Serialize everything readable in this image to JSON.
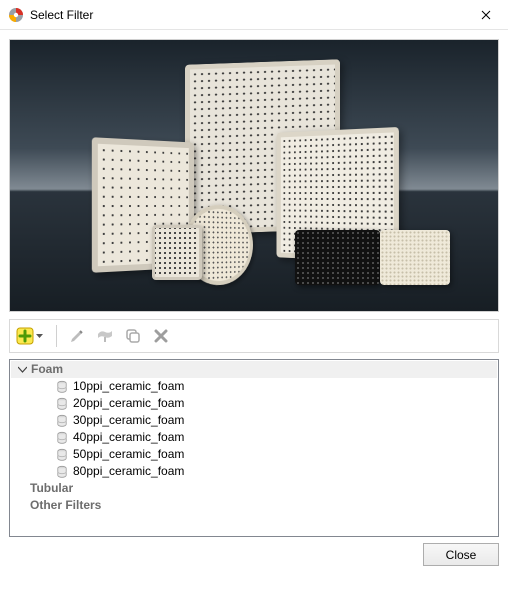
{
  "window": {
    "title": "Select Filter",
    "close_tooltip": "Close"
  },
  "toolbar": {
    "add_tooltip": "Add",
    "edit_tooltip": "Edit",
    "filter_tooltip": "Filter",
    "copy_tooltip": "Copy",
    "delete_tooltip": "Delete"
  },
  "tree": {
    "categories": [
      {
        "name": "Foam",
        "expanded": true,
        "selected": true,
        "items": [
          "10ppi_ceramic_foam",
          "20ppi_ceramic_foam",
          "30ppi_ceramic_foam",
          "40ppi_ceramic_foam",
          "50ppi_ceramic_foam",
          "80ppi_ceramic_foam"
        ]
      },
      {
        "name": "Tubular",
        "expanded": false,
        "selected": false,
        "items": []
      },
      {
        "name": "Other Filters",
        "expanded": false,
        "selected": false,
        "items": []
      }
    ]
  },
  "footer": {
    "close_label": "Close"
  }
}
